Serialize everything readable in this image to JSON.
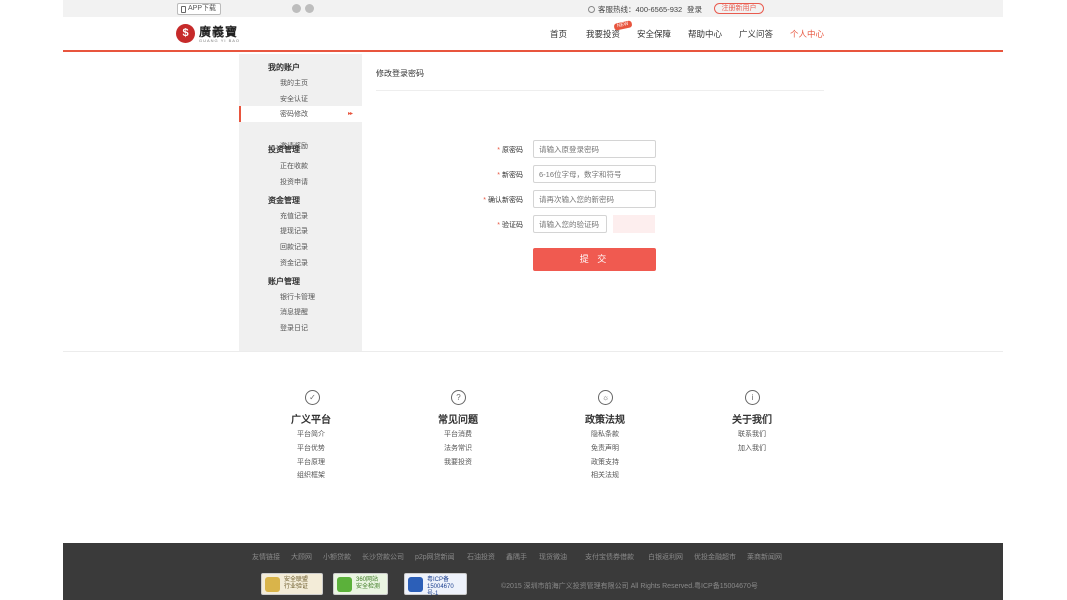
{
  "topbar": {
    "app_download": "APP下载",
    "hotline": "客服热线：400-6565-932",
    "login": "登录",
    "register": "注册新用户"
  },
  "header": {
    "logo_text": "廣義寶",
    "logo_sub": "GUANG YI BAO",
    "nav": [
      "首页",
      "我要投资",
      "安全保障",
      "帮助中心",
      "广义问答",
      "个人中心"
    ],
    "new_badge": "NEW",
    "accent": "#e8553e"
  },
  "sidebar": {
    "groups": [
      {
        "title": "我的账户",
        "items": [
          "我的主页",
          "安全认证",
          "密码修改",
          "邀请奖励"
        ]
      },
      {
        "title": "投资管理",
        "items": [
          "正在收款",
          "投资申请"
        ]
      },
      {
        "title": "资金管理",
        "items": [
          "充值记录",
          "提现记录",
          "回款记录",
          "资金记录"
        ]
      },
      {
        "title": "账户管理",
        "items": [
          "银行卡管理",
          "消息提醒",
          "登录日记"
        ]
      }
    ],
    "active_item": "密码修改"
  },
  "form": {
    "title": "修改登录密码",
    "fields": [
      {
        "label": "原密码",
        "placeholder": "请输入原登录密码"
      },
      {
        "label": "新密码",
        "placeholder": "6-16位字母，数字和符号"
      },
      {
        "label": "确认新密码",
        "placeholder": "请再次输入您的新密码"
      },
      {
        "label": "验证码",
        "placeholder": "请输入您的验证码"
      }
    ],
    "submit": "提 交"
  },
  "footer_columns": [
    {
      "icon": "shield-check-icon",
      "title": "广义平台",
      "links": [
        "平台简介",
        "平台优势",
        "平台原理",
        "组织框架"
      ]
    },
    {
      "icon": "question-icon",
      "title": "常见问题",
      "links": [
        "平台消费",
        "法务常识",
        "我要投资"
      ]
    },
    {
      "icon": "sunrise-icon",
      "title": "政策法规",
      "links": [
        "隐私条款",
        "免责声明",
        "政策支持",
        "相关法规"
      ]
    },
    {
      "icon": "info-icon",
      "title": "关于我们",
      "links": [
        "联系我们",
        "加入我们"
      ]
    }
  ],
  "bottom": {
    "friend_links": [
      "友情链接",
      "大顾网",
      "小额贷款",
      "长沙贷款公司",
      "p2p网贷新闻",
      "石油投资",
      "鑫隅手",
      "现货微油",
      "支付宝债券借款",
      "白银返利网",
      "优投金融超市",
      "莱商新闻网"
    ],
    "badges": [
      {
        "line1": "安全联盟",
        "line2": "行业验证"
      },
      {
        "line1": "360网站",
        "line2": "安全检测"
      },
      {
        "line1": "粤ICP备",
        "line2": "15004670号-1"
      }
    ],
    "copyright": "©2015 深圳市前海广义投资管理有限公司  All Rights Reserved.粤ICP备15004670号"
  }
}
